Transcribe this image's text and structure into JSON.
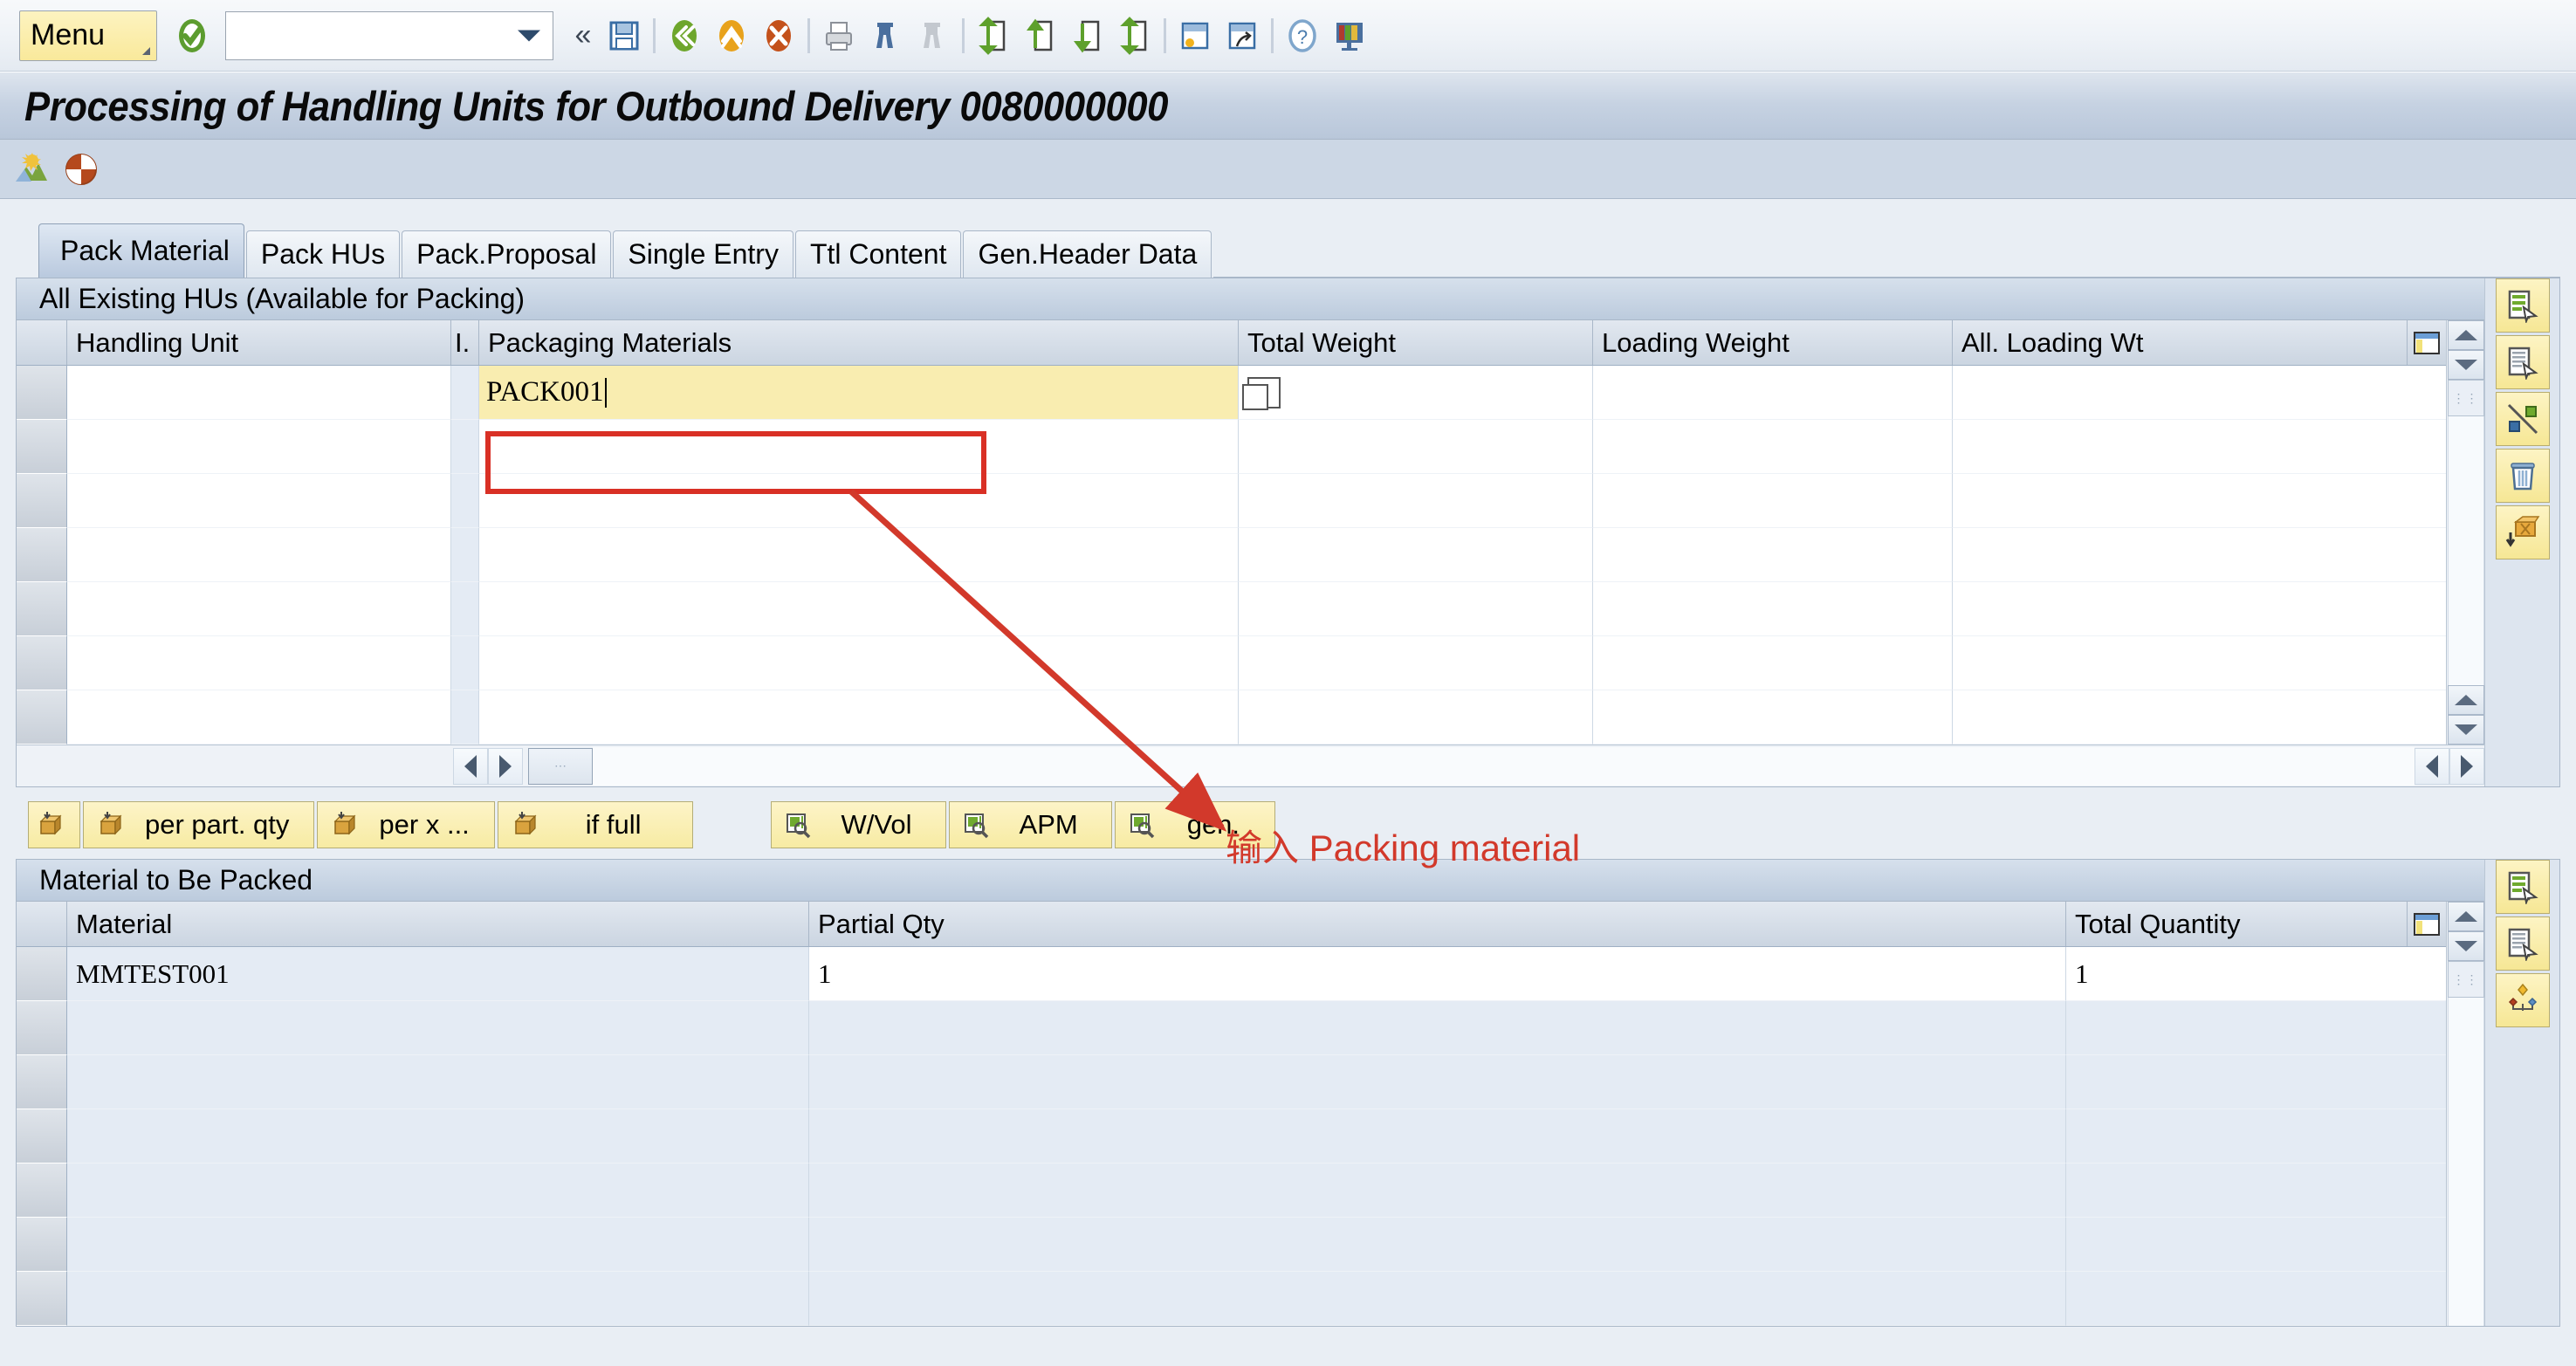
{
  "toolbar": {
    "menu_label": "Menu",
    "command_field_value": "",
    "command_field_placeholder": "",
    "icons": [
      {
        "name": "enter-check-icon",
        "title": "Continue (Enter)"
      },
      {
        "name": "collapse-chevrons-icon",
        "title": "Collapse"
      },
      {
        "name": "save-icon",
        "title": "Save"
      },
      {
        "name": "back-icon",
        "title": "Back"
      },
      {
        "name": "exit-icon",
        "title": "Exit"
      },
      {
        "name": "cancel-icon",
        "title": "Cancel"
      },
      {
        "name": "print-icon",
        "title": "Print"
      },
      {
        "name": "find-icon",
        "title": "Find"
      },
      {
        "name": "find-next-icon",
        "title": "Find Next"
      },
      {
        "name": "first-page-icon",
        "title": "First Page"
      },
      {
        "name": "previous-page-icon",
        "title": "Previous Page"
      },
      {
        "name": "next-page-icon",
        "title": "Next Page"
      },
      {
        "name": "last-page-icon",
        "title": "Last Page"
      },
      {
        "name": "create-session-icon",
        "title": "Create New Session"
      },
      {
        "name": "create-shortcut-icon",
        "title": "Create Shortcut"
      },
      {
        "name": "help-icon",
        "title": "Help"
      },
      {
        "name": "customize-layout-icon",
        "title": "Customize Local Layout"
      }
    ]
  },
  "title": "Processing of Handling Units for Outbound Delivery 0080000000",
  "app_toolbar": {
    "icons": [
      {
        "name": "overview-picture-icon",
        "title": "Overview"
      },
      {
        "name": "status-pie-icon",
        "title": "Status"
      }
    ]
  },
  "tabs": [
    {
      "label": "Pack Material",
      "active": true
    },
    {
      "label": "Pack HUs",
      "active": false
    },
    {
      "label": "Pack.Proposal",
      "active": false
    },
    {
      "label": "Single Entry",
      "active": false
    },
    {
      "label": "Ttl Content",
      "active": false
    },
    {
      "label": "Gen.Header Data",
      "active": false
    }
  ],
  "hu_section": {
    "header": "All Existing HUs (Available for Packing)",
    "columns": [
      "Handling Unit",
      "I.",
      "Packaging Materials",
      "Total Weight",
      "Loading Weight",
      "All. Loading Wt"
    ],
    "rows": [
      {
        "handling_unit": "",
        "indicator": "",
        "packaging_materials": "PACK001",
        "total_weight": "",
        "loading_weight": "",
        "all_loading_wt": "",
        "editing": true
      }
    ],
    "empty_row_count": 6,
    "rail_buttons": [
      {
        "name": "details-green-button",
        "icon": "details-green-icon"
      },
      {
        "name": "details-list-button",
        "icon": "details-list-icon"
      },
      {
        "name": "unpack-cut-button",
        "icon": "unpack-cut-icon"
      },
      {
        "name": "delete-button",
        "icon": "trash-icon"
      },
      {
        "name": "unload-hu-button",
        "icon": "unload-hu-icon"
      }
    ]
  },
  "pack_buttons": {
    "left_group": [
      {
        "label": "",
        "icon": "pack-icon",
        "name": "pack-button"
      },
      {
        "label": "per part. qty",
        "icon": "pack-icon",
        "name": "pack-per-partial-qty-button"
      },
      {
        "label": "per x ...",
        "icon": "pack-icon",
        "name": "pack-per-x-button"
      },
      {
        "label": "if full",
        "icon": "pack-icon",
        "name": "pack-if-full-button"
      }
    ],
    "right_group": [
      {
        "label": "W/Vol",
        "icon": "magnifier-list-icon",
        "name": "weight-volume-button"
      },
      {
        "label": "APM",
        "icon": "magnifier-list-icon",
        "name": "apm-button"
      },
      {
        "label": "gen.",
        "icon": "magnifier-list-icon",
        "name": "general-button"
      }
    ]
  },
  "material_section": {
    "header": "Material to Be Packed",
    "columns": [
      "Material",
      "Partial Qty",
      "Total Quantity"
    ],
    "rows": [
      {
        "material": "MMTEST001",
        "partial_qty": "1",
        "total_quantity": "1"
      }
    ],
    "empty_row_count": 6,
    "rail_buttons": [
      {
        "name": "material-details-green-button",
        "icon": "details-green-icon"
      },
      {
        "name": "material-details-list-button",
        "icon": "details-list-icon"
      },
      {
        "name": "distribute-button",
        "icon": "distribute-icon"
      }
    ]
  },
  "annotation": {
    "text": "输入 Packing material",
    "color": "#d2392b"
  },
  "colors": {
    "accent_red": "#d93025",
    "input_yellow": "#f9edb0",
    "button_yellow": "#fdf4c8",
    "header_blue": "#bccbdd",
    "body_bg": "#e9eef4"
  }
}
